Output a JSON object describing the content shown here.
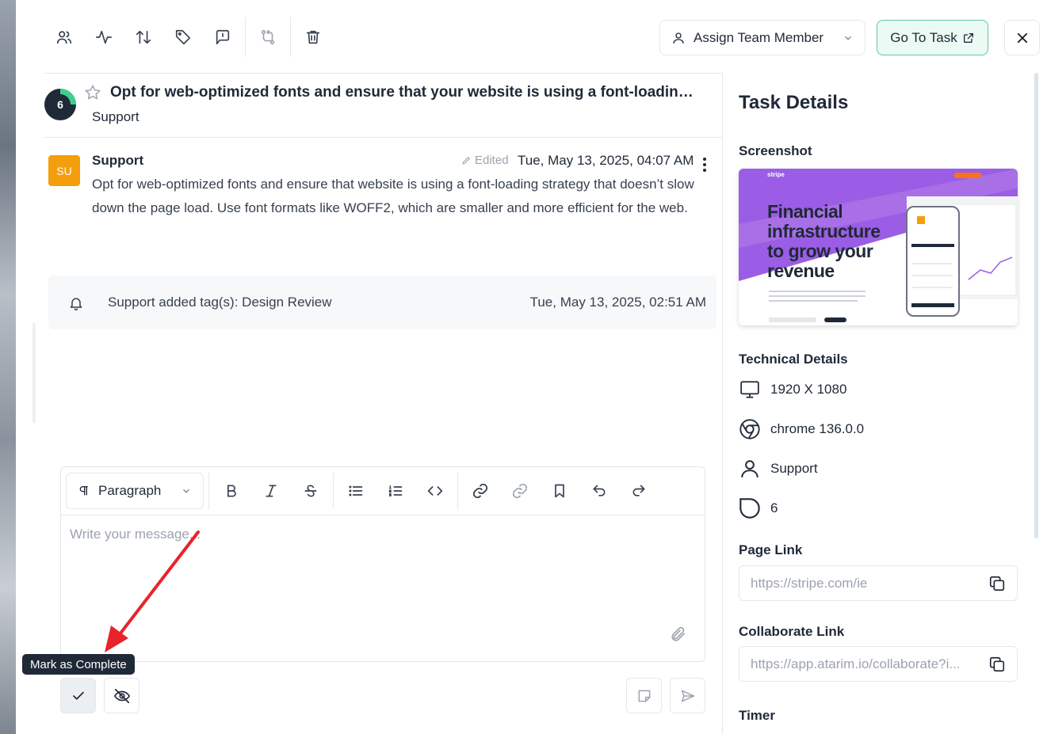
{
  "toolbar": {
    "icons": [
      "users-icon",
      "activity-icon",
      "sort-icon",
      "tag-icon",
      "flag-message-icon",
      "merge-icon",
      "trash-icon"
    ],
    "assign_label": "Assign Team Member",
    "goto_label": "Go To Task"
  },
  "task": {
    "number": "6",
    "title": "Opt for web-optimized fonts and ensure that your website is using a font-loading strategy that doesn't slow down the page load.",
    "subtitle": "Support"
  },
  "message": {
    "avatar_initials": "SU",
    "author": "Support",
    "edited_label": "Edited",
    "date": "Tue, May 13, 2025, 04:07 AM",
    "body": "Opt for web-optimized fonts and ensure that website is using a font-loading strategy that doesn’t slow down the page load. Use font formats like WOFF2, which are smaller and more efficient for the web."
  },
  "activity": {
    "text": "Support added tag(s): Design Review",
    "date": "Tue, May 13, 2025, 02:51 AM"
  },
  "editor": {
    "paragraph_label": "Paragraph",
    "placeholder": "Write your message..."
  },
  "tooltip": "Mark as Complete",
  "details": {
    "title": "Task Details",
    "screenshot_label": "Screenshot",
    "screenshot_headline": "Financial infrastructure to grow your revenue",
    "screenshot_brand": "stripe",
    "technical_label": "Technical Details",
    "resolution": "1920 X 1080",
    "browser": "chrome 136.0.0",
    "user": "Support",
    "task_number": "6",
    "page_link_label": "Page Link",
    "page_link": "https://stripe.com/ie",
    "collab_label": "Collaborate Link",
    "collab_link": "https://app.atarim.io/collaborate?i...",
    "timer_label": "Timer"
  },
  "colors": {
    "accent_green": "#5ec8a4",
    "avatar_orange": "#f59e0b",
    "screenshot_purple": "#9b5de5"
  }
}
